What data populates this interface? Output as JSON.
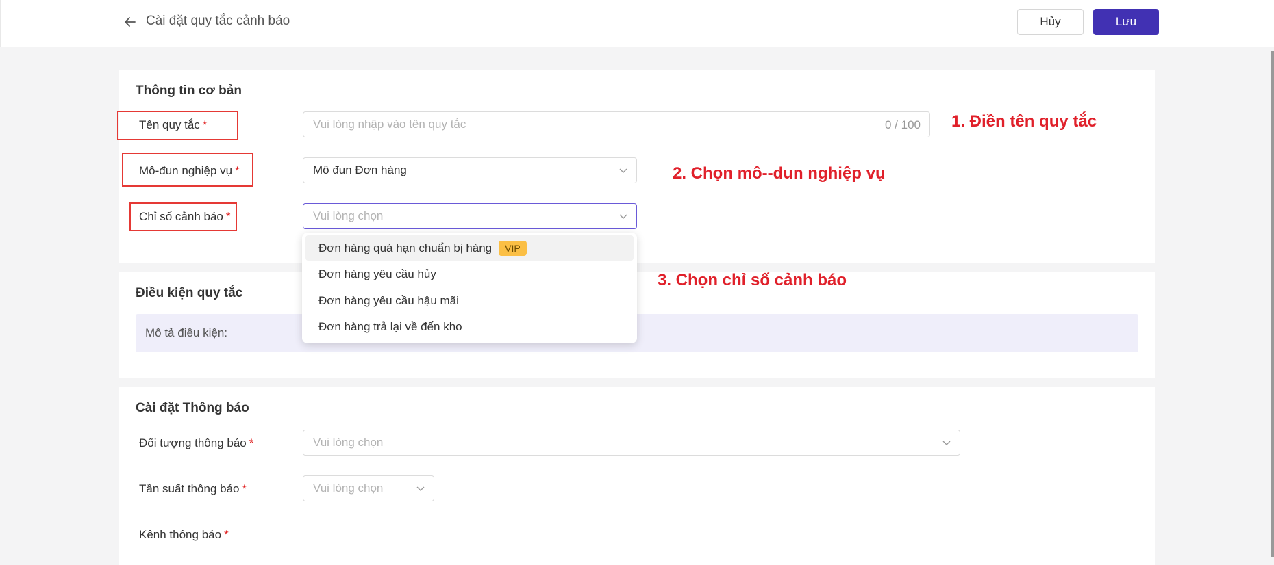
{
  "header": {
    "title": "Cài đặt quy tắc cảnh báo",
    "cancel_label": "Hủy",
    "save_label": "Lưu"
  },
  "basic_info": {
    "title": "Thông tin cơ bản",
    "rule_name": {
      "label": "Tên quy tắc",
      "placeholder": "Vui lòng nhập vào tên quy tắc",
      "value": "",
      "counter": "0 / 100"
    },
    "business_module": {
      "label": "Mô-đun nghiệp vụ",
      "value": "Mô đun Đơn hàng"
    },
    "alert_metric": {
      "label": "Chỉ số cảnh báo",
      "placeholder": "Vui lòng chọn",
      "options": [
        {
          "label": "Đơn hàng quá hạn chuẩn bị hàng",
          "badge": "VIP"
        },
        {
          "label": "Đơn hàng yêu cầu hủy"
        },
        {
          "label": "Đơn hàng yêu cầu hậu mãi"
        },
        {
          "label": "Đơn hàng trả lại về đến kho"
        }
      ]
    }
  },
  "rule_conditions": {
    "title": "Điều kiện quy tắc",
    "description_label": "Mô tả điều kiện:"
  },
  "notification_settings": {
    "title": "Cài đặt Thông báo",
    "target": {
      "label": "Đối tượng thông báo",
      "placeholder": "Vui lòng chọn"
    },
    "frequency": {
      "label": "Tần suất thông báo",
      "placeholder": "Vui lòng chọn"
    },
    "channel": {
      "label": "Kênh thông báo"
    }
  },
  "required_mark": "*",
  "annotations": {
    "step1": "1. Điền tên quy tắc",
    "step2": "2. Chọn mô--dun nghiệp vụ",
    "step3": "3. Chọn chỉ số cảnh báo"
  },
  "colors": {
    "primary": "#4131b3",
    "annotation_red": "#e0202a",
    "required_red": "#e02020",
    "vip_badge": "#fbbf45",
    "description_bg": "#efeefa"
  },
  "icons": {
    "back": "arrow-left-icon",
    "dropdown": "chevron-down-icon"
  }
}
